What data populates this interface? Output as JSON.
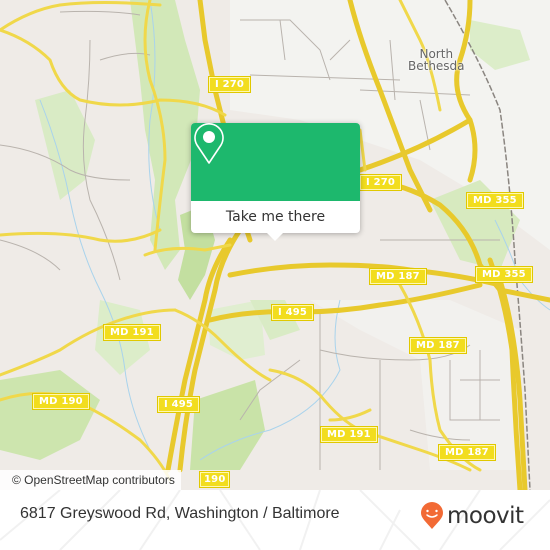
{
  "map": {
    "places": [
      {
        "name": "North Bethesda",
        "line1": "North",
        "line2": "Bethesda"
      }
    ],
    "shields": [
      {
        "label": "I 270"
      },
      {
        "label": "I 270"
      },
      {
        "label": "MD 355"
      },
      {
        "label": "MD 187"
      },
      {
        "label": "MD 355"
      },
      {
        "label": "I 495"
      },
      {
        "label": "MD 191"
      },
      {
        "label": "MD 187"
      },
      {
        "label": "MD 190"
      },
      {
        "label": "I 495"
      },
      {
        "label": "MD 191"
      },
      {
        "label": "MD 187"
      },
      {
        "label": "190"
      }
    ],
    "attribution": "© OpenStreetMap contributors"
  },
  "popup": {
    "icon": "map-pin-icon",
    "button_label": "Take me there",
    "color": "#1db86d"
  },
  "footer": {
    "address": "6817 Greyswood Rd, Washington / Baltimore",
    "logo_text": "moovit",
    "logo_color": "#f26a35"
  }
}
